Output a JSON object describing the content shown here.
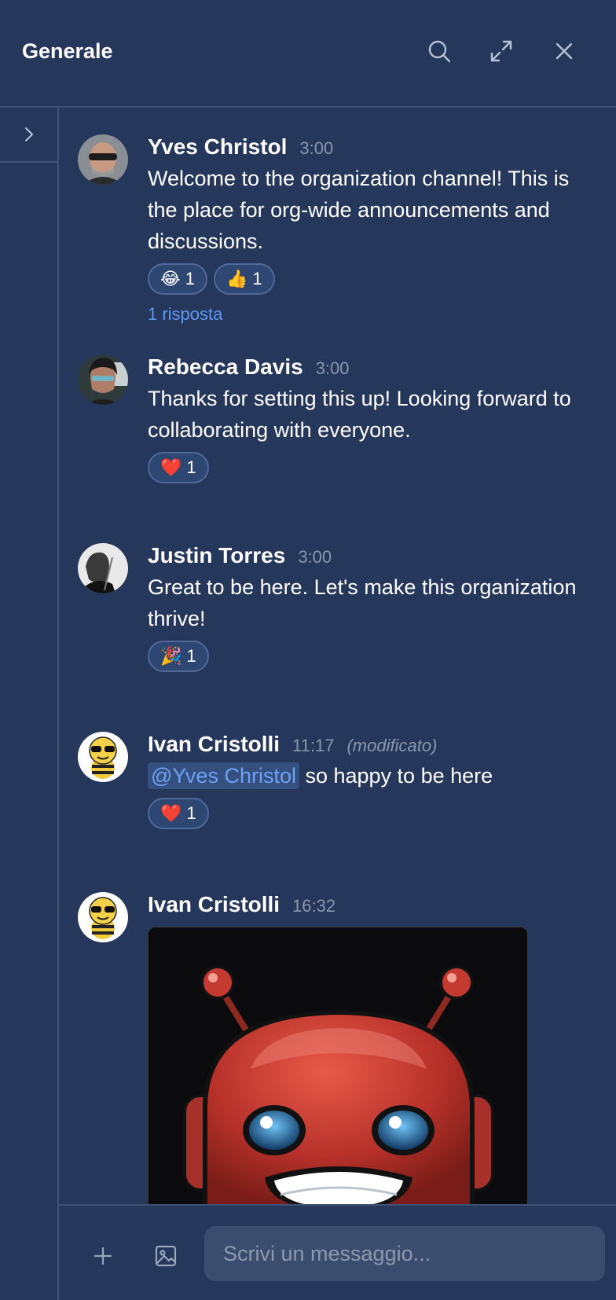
{
  "header": {
    "title": "Generale"
  },
  "composer": {
    "placeholder": "Scrivi un messaggio..."
  },
  "messages": [
    {
      "author": "Yves Christol",
      "time": "3:00",
      "text": "Welcome to the organization channel! This is the place for org-wide announcements and discussions.",
      "reactions": [
        {
          "emoji": "😂",
          "count": "1"
        },
        {
          "emoji": "👍",
          "count": "1"
        }
      ],
      "reply": "1 risposta"
    },
    {
      "author": "Rebecca Davis",
      "time": "3:00",
      "text": "Thanks for setting this up! Looking forward to collaborating with everyone.",
      "reactions": [
        {
          "emoji": "❤️",
          "count": "1"
        }
      ]
    },
    {
      "author": "Justin Torres",
      "time": "3:00",
      "text": "Great to be here. Let's make this organization thrive!",
      "reactions": [
        {
          "emoji": "🎉",
          "count": "1"
        }
      ]
    },
    {
      "author": "Ivan Cristolli",
      "time": "11:17",
      "edited": "(modificato)",
      "mention": "@Yves Christol",
      "text": " so happy to be here",
      "reactions": [
        {
          "emoji": "❤️",
          "count": "1"
        }
      ]
    },
    {
      "author": "Ivan Cristolli",
      "time": "16:32"
    }
  ],
  "colors": {
    "background": "#25385b",
    "divider": "#3d5175",
    "link": "#5e96f2",
    "mention": "#6ea0f5",
    "reaction_bg": "#2e4672",
    "input_bg": "#3a4d6f"
  },
  "icons": [
    "search-icon",
    "expand-icon",
    "close-icon",
    "chevron-right-icon",
    "plus-icon",
    "image-icon"
  ]
}
